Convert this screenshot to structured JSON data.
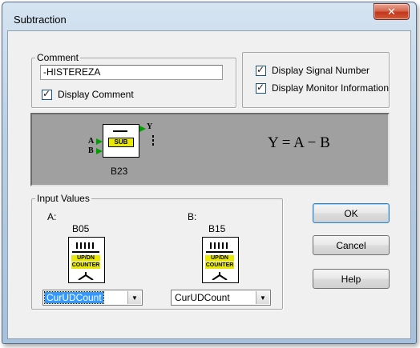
{
  "window": {
    "title": "Subtraction",
    "close_glyph": "✕"
  },
  "comment": {
    "legend": "Comment",
    "value": "-HISTEREZA",
    "display_comment_label": "Display Comment",
    "display_comment_checked": true
  },
  "options": {
    "display_signal_number_label": "Display Signal Number",
    "display_signal_number_checked": true,
    "display_monitor_info_label": "Display Monitor Information",
    "display_monitor_info_checked": true
  },
  "preview": {
    "block_text": "SUB",
    "input_a": "A",
    "input_b": "B",
    "output_y": "Y",
    "block_id": "B23",
    "formula": "Y = A − B"
  },
  "inputs": {
    "legend": "Input Values",
    "a": {
      "label": "A:",
      "block_id": "B05",
      "icon_top": "UP/DN",
      "icon_bottom": "COUNTER",
      "selected": "CurUDCount"
    },
    "b": {
      "label": "B:",
      "block_id": "B15",
      "icon_top": "UP/DN",
      "icon_bottom": "COUNTER",
      "selected": "CurUDCount"
    }
  },
  "buttons": {
    "ok": "OK",
    "cancel": "Cancel",
    "help": "Help"
  },
  "glyphs": {
    "check": "✓",
    "dropdown": "▼"
  },
  "colors": {
    "preview_bg": "#a0a0a0",
    "block_yellow": "#e8e800",
    "connector_green": "#00a000",
    "selection_blue": "#3399ff"
  }
}
